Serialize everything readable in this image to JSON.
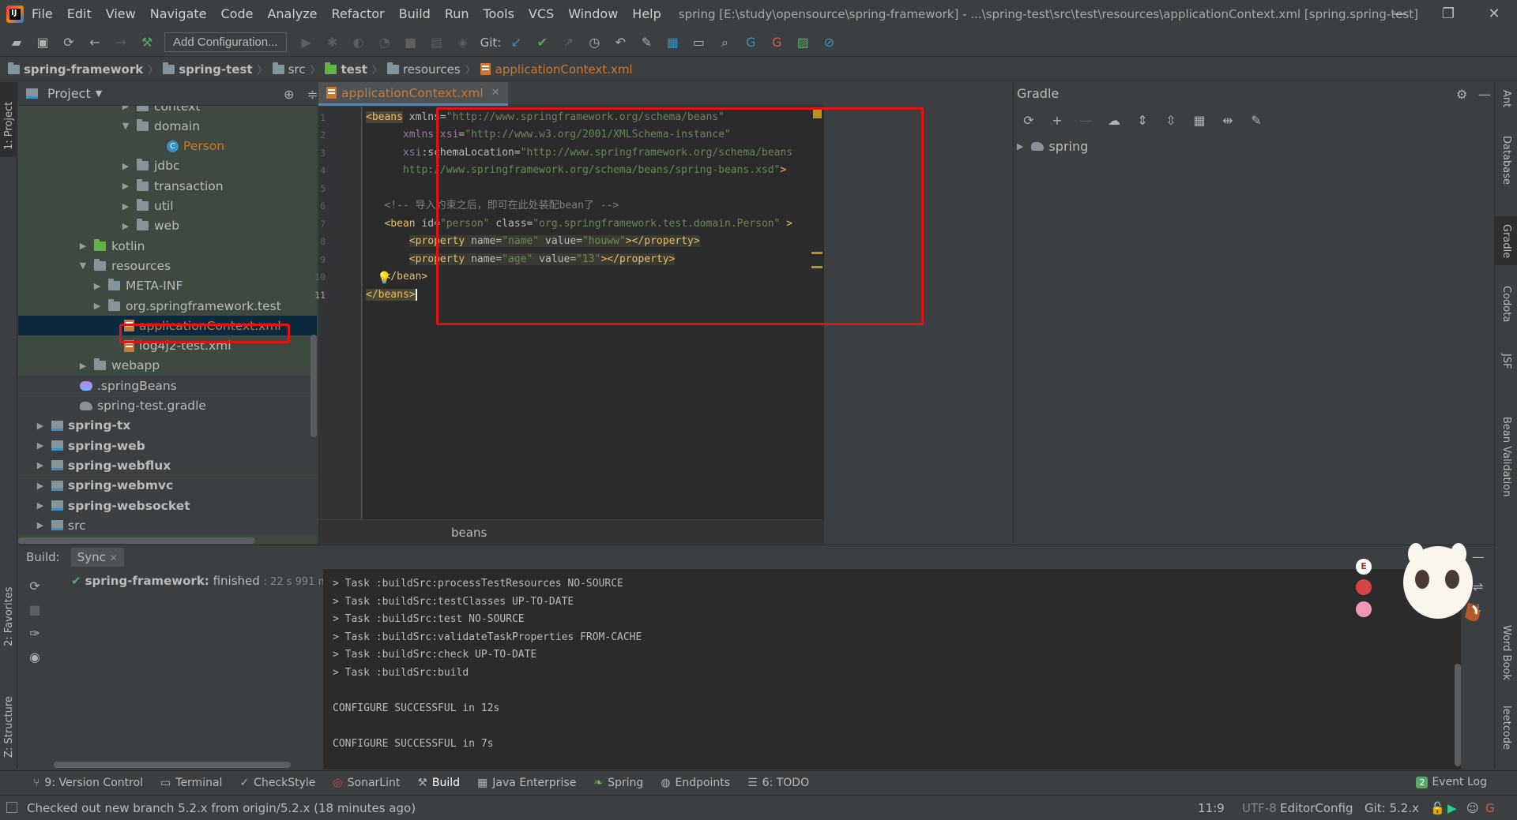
{
  "app": {
    "window_title": "spring [E:\\study\\opensource\\spring-framework] - ...\\spring-test\\src\\test\\resources\\applicationContext.xml [spring.spring-test]",
    "menu": [
      "File",
      "Edit",
      "View",
      "Navigate",
      "Code",
      "Analyze",
      "Refactor",
      "Build",
      "Run",
      "Tools",
      "VCS",
      "Window",
      "Help"
    ],
    "logo_text": "IJ"
  },
  "toolbar": {
    "add_configuration": "Add Configuration...",
    "git_label": "Git:"
  },
  "breadcrumb": [
    "spring-framework",
    "spring-test",
    "src",
    "test",
    "resources",
    "applicationContext.xml"
  ],
  "left_strip": {
    "project_tab": "1: Project",
    "favorites_tab": "2: Favorites",
    "structure_tab": "Z: Structure"
  },
  "project": {
    "title": "Project",
    "tree": [
      {
        "label": "context",
        "type": "folder",
        "expanded": false
      },
      {
        "label": "domain",
        "type": "folder",
        "expanded": true
      },
      {
        "label": "Person",
        "type": "class"
      },
      {
        "label": "jdbc",
        "type": "folder",
        "expanded": false
      },
      {
        "label": "transaction",
        "type": "folder",
        "expanded": false
      },
      {
        "label": "util",
        "type": "folder",
        "expanded": false
      },
      {
        "label": "web",
        "type": "folder",
        "expanded": false
      },
      {
        "label": "kotlin",
        "type": "folder",
        "expanded": false
      },
      {
        "label": "resources",
        "type": "folder",
        "expanded": true
      },
      {
        "label": "META-INF",
        "type": "folder",
        "expanded": false
      },
      {
        "label": "org.springframework.test",
        "type": "folder",
        "expanded": false
      },
      {
        "label": "applicationContext.xml",
        "type": "xml",
        "selected": true
      },
      {
        "label": "log4j2-test.xml",
        "type": "xml"
      },
      {
        "label": "webapp",
        "type": "folder",
        "expanded": false
      },
      {
        "label": ".springBeans",
        "type": "beans"
      },
      {
        "label": "spring-test.gradle",
        "type": "gradle"
      },
      {
        "label": "spring-tx",
        "type": "module"
      },
      {
        "label": "spring-web",
        "type": "module"
      },
      {
        "label": "spring-webflux",
        "type": "module"
      },
      {
        "label": "spring-webmvc",
        "type": "module"
      },
      {
        "label": "spring-websocket",
        "type": "module"
      },
      {
        "label": "src",
        "type": "module-plain"
      }
    ]
  },
  "editor": {
    "tab_label": "applicationContext.xml",
    "line_numbers": [
      "1",
      "2",
      "3",
      "4",
      "5",
      "6",
      "7",
      "8",
      "9",
      "10",
      "11"
    ],
    "code": {
      "l1_tag": "<beans",
      "l1_attr": " xmlns=",
      "l1_val": "\"http://www.springframework.org/schema/beans\"",
      "l2_ns": "xmlns:xsi",
      "l2_eq": "=",
      "l2_val": "\"http://www.w3.org/2001/XMLSchema-instance\"",
      "l3_ns": "xsi",
      "l3_attr": ":schemaLocation=",
      "l3_val": "\"http://www.springframework.org/schema/beans",
      "l4_val": "http://www.springframework.org/schema/beans/spring-beans.xsd\"",
      "l4_end": ">",
      "l6_comment": "<!-- 导入约束之后，即可在此处装配bean了 -->",
      "l7_tag": "<bean",
      "l7_attr1": " id=",
      "l7_val1": "\"person\"",
      "l7_attr2": " class=",
      "l7_val2": "\"org.springframework.test.domain.Person\"",
      "l7_end": " >",
      "l8_tag": "<property",
      "l8_attr1": " name=",
      "l8_val1": "\"name\"",
      "l8_attr2": " value=",
      "l8_val2": "\"houww\"",
      "l8_end": "></property>",
      "l9_tag": "<property",
      "l9_attr1": " name=",
      "l9_val1": "\"age\"",
      "l9_attr2": " value=",
      "l9_val2": "\"13\"",
      "l9_end": "></property>",
      "l10": "</bean>",
      "l11": "</beans>"
    },
    "bottom_breadcrumb": "beans"
  },
  "gradle": {
    "title": "Gradle",
    "root": "spring"
  },
  "right_strip": [
    "Ant",
    "Database",
    "Gradle",
    "Codota",
    "JSF",
    "Bean Validation",
    "Word Book",
    "leetcode"
  ],
  "build": {
    "label": "Build:",
    "sync_tab": "Sync",
    "status_name": "spring-framework:",
    "status_text": " finished",
    "status_time": "22 s 991 ms",
    "console": [
      "> Task :buildSrc:processTestResources NO-SOURCE",
      "> Task :buildSrc:testClasses UP-TO-DATE",
      "> Task :buildSrc:test NO-SOURCE",
      "> Task :buildSrc:validateTaskProperties FROM-CACHE",
      "> Task :buildSrc:check UP-TO-DATE",
      "> Task :buildSrc:build",
      "",
      "CONFIGURE SUCCESSFUL in 12s",
      "",
      "CONFIGURE SUCCESSFUL in 7s"
    ]
  },
  "bottom_tabs": [
    {
      "label": "9: Version Control",
      "icon": "vcs-icon"
    },
    {
      "label": "Terminal",
      "icon": "terminal-icon"
    },
    {
      "label": "CheckStyle",
      "icon": "checkstyle-icon"
    },
    {
      "label": "SonarLint",
      "icon": "sonarlint-icon"
    },
    {
      "label": "Build",
      "icon": "hammer-icon"
    },
    {
      "label": "Java Enterprise",
      "icon": "java-enterprise-icon"
    },
    {
      "label": "Spring",
      "icon": "spring-icon"
    },
    {
      "label": "Endpoints",
      "icon": "endpoints-icon"
    },
    {
      "label": "6: TODO",
      "icon": "todo-icon"
    }
  ],
  "event_log": {
    "label": "Event Log",
    "count": "2"
  },
  "statusbar": {
    "message": "Checked out new branch 5.2.x from origin/5.2.x (18 minutes ago)",
    "position": "11:9",
    "encoding": "UTF-8",
    "editorconfig": "EditorConfig",
    "git_branch": "Git: 5.2.x"
  },
  "colors": {
    "accent_red_box": "#e01414",
    "xml_tag": "#e8bf6a",
    "xml_value": "#6a8759",
    "selection": "#0d293e"
  }
}
